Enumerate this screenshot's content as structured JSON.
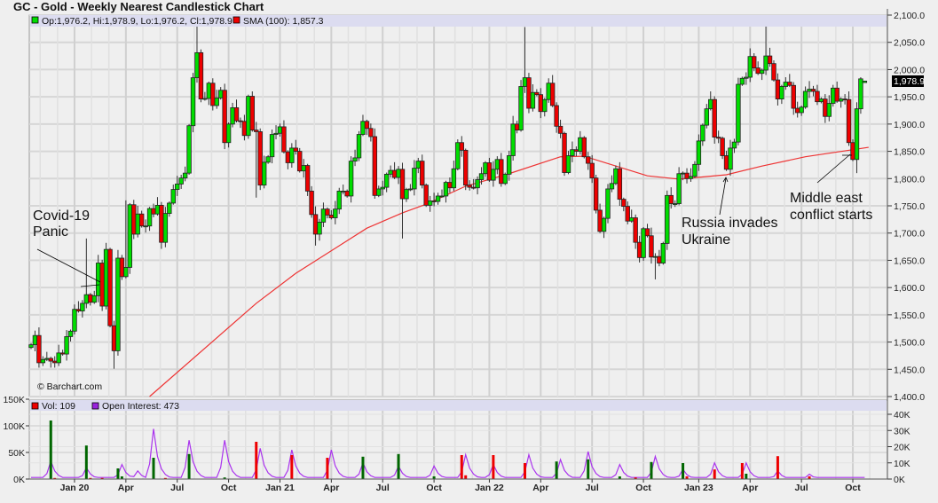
{
  "title": "GC - Gold - Weekly Nearest Candlestick Chart",
  "legend": {
    "ohlc": "Op:1,976.2, Hi:1,978.9, Lo:1,976.2, Cl:1,978.9",
    "sma": "SMA (100): 1,857.3",
    "vol": "Vol: 109",
    "oi": "Open Interest: 473"
  },
  "watermark": "© Barchart.com",
  "last_price_label": "1,978.9",
  "colors": {
    "up": "#00dd00",
    "down": "#ee0000",
    "sma": "#ee3333",
    "oi": "#aa33ee",
    "vol_up": "#006600",
    "vol_down": "#ee0000",
    "legend_band": "#dcdcf0"
  },
  "annotations": [
    {
      "lines": [
        "Covid-19",
        "Panic"
      ]
    },
    {
      "lines": [
        "Russia invades",
        "Ukraine"
      ]
    },
    {
      "lines": [
        "Middle east",
        "conflict starts"
      ]
    }
  ],
  "chart_data": {
    "type": "candlestick",
    "title": "GC - Gold - Weekly Nearest Candlestick Chart",
    "price_axis": {
      "range": [
        1400,
        2100
      ],
      "ticks": [
        "2,100.0",
        "2,050.0",
        "2,000.0",
        "1,950.0",
        "1,900.0",
        "1,850.0",
        "1,800.0",
        "1,750.0",
        "1,700.0",
        "1,650.0",
        "1,600.0",
        "1,550.0",
        "1,500.0",
        "1,450.0",
        "1,400.0"
      ],
      "tick_values": [
        2100,
        2050,
        2000,
        1950,
        1900,
        1850,
        1800,
        1750,
        1700,
        1650,
        1600,
        1550,
        1500,
        1450,
        1400
      ]
    },
    "x_ticks": [
      {
        "label": "Jan 20",
        "week": 11
      },
      {
        "label": "Apr",
        "week": 24
      },
      {
        "label": "Jul",
        "week": 37
      },
      {
        "label": "Oct",
        "week": 50
      },
      {
        "label": "Jan 21",
        "week": 63
      },
      {
        "label": "Apr",
        "week": 76
      },
      {
        "label": "Jul",
        "week": 89
      },
      {
        "label": "Oct",
        "week": 102
      },
      {
        "label": "Jan 22",
        "week": 116
      },
      {
        "label": "Apr",
        "week": 129
      },
      {
        "label": "Jul",
        "week": 142
      },
      {
        "label": "Oct",
        "week": 155
      },
      {
        "label": "Jan 23",
        "week": 169
      },
      {
        "label": "Apr",
        "week": 182
      },
      {
        "label": "Jul",
        "week": 195
      },
      {
        "label": "Oct",
        "week": 208
      }
    ],
    "first_open": 1490,
    "weekly_close": [
      1495,
      1512,
      1462,
      1468,
      1470,
      1465,
      1462,
      1480,
      1478,
      1510,
      1520,
      1560,
      1557,
      1571,
      1587,
      1573,
      1585,
      1645,
      1566,
      1670,
      1530,
      1484,
      1654,
      1620,
      1637,
      1752,
      1698,
      1735,
      1713,
      1713,
      1745,
      1735,
      1751,
      1683,
      1736,
      1755,
      1780,
      1790,
      1801,
      1810,
      1897,
      1985,
      2031,
      1946,
      1947,
      1975,
      1934,
      1948,
      1962,
      1866,
      1900,
      1930,
      1906,
      1905,
      1879,
      1951,
      1889,
      1886,
      1788,
      1830,
      1840,
      1881,
      1883,
      1895,
      1849,
      1829,
      1856,
      1850,
      1814,
      1824,
      1777,
      1734,
      1698,
      1720,
      1744,
      1733,
      1728,
      1744,
      1777,
      1777,
      1768,
      1832,
      1838,
      1881,
      1905,
      1892,
      1877,
      1769,
      1781,
      1784,
      1808,
      1815,
      1802,
      1817,
      1763,
      1780,
      1781,
      1819,
      1832,
      1788,
      1751,
      1759,
      1758,
      1768,
      1768,
      1793,
      1783,
      1818,
      1866,
      1852,
      1788,
      1784,
      1783,
      1798,
      1809,
      1829,
      1797,
      1817,
      1835,
      1791,
      1808,
      1842,
      1900,
      1889,
      1969,
      1985,
      1929,
      1958,
      1954,
      1923,
      1945,
      1975,
      1934,
      1896,
      1883,
      1811,
      1842,
      1853,
      1850,
      1875,
      1840,
      1828,
      1801,
      1742,
      1703,
      1727,
      1781,
      1791,
      1818,
      1762,
      1749,
      1722,
      1728,
      1683,
      1655,
      1708,
      1695,
      1656,
      1657,
      1645,
      1681,
      1769,
      1754,
      1754,
      1809,
      1810,
      1800,
      1804,
      1826,
      1869,
      1898,
      1928,
      1945,
      1876,
      1874,
      1842,
      1817,
      1856,
      1867,
      1973,
      1984,
      1986,
      2024,
      2003,
      1993,
      1999,
      2025,
      2011,
      1981,
      1946,
      1969,
      1977,
      1971,
      1929,
      1921,
      1931,
      1960,
      1964,
      1960,
      1941,
      1946,
      1914,
      1938,
      1966,
      1942,
      1946,
      1945,
      1866,
      1835,
      1928,
      1983
    ],
    "last_bar": {
      "open": 1976.2,
      "high": 1978.9,
      "low": 1976.2,
      "close": 1978.9
    },
    "high_overrides": [
      [
        42,
        2089
      ],
      [
        125,
        2078
      ],
      [
        186,
        2085
      ],
      [
        24,
        1760
      ],
      [
        14,
        1690
      ]
    ],
    "low_overrides": [
      [
        21,
        1451
      ],
      [
        57,
        1765
      ],
      [
        72,
        1677
      ],
      [
        94,
        1690
      ],
      [
        158,
        1615
      ],
      [
        209,
        1810
      ]
    ],
    "sma_100": {
      "label": "SMA (100)",
      "last": 1857.3,
      "points": [
        [
          30,
          1400
        ],
        [
          57,
          1571
        ],
        [
          67,
          1626
        ],
        [
          85,
          1709
        ],
        [
          94,
          1737
        ],
        [
          100,
          1753
        ],
        [
          110,
          1786
        ],
        [
          121,
          1809
        ],
        [
          134,
          1840
        ],
        [
          140,
          1841
        ],
        [
          156,
          1805
        ],
        [
          164,
          1799
        ],
        [
          176,
          1807
        ],
        [
          185,
          1823
        ],
        [
          196,
          1840
        ],
        [
          212,
          1857.3
        ]
      ]
    },
    "volume_axis": {
      "range": [
        0,
        150
      ],
      "unit": "K",
      "ticks": [
        "150K",
        "100K",
        "50K",
        "0K"
      ],
      "tick_values": [
        150,
        100,
        50,
        0
      ]
    },
    "oi_axis": {
      "range": [
        0,
        40
      ],
      "unit": "K",
      "ticks": [
        "40K",
        "30K",
        "20K",
        "10K",
        "0K"
      ],
      "tick_values": [
        40,
        30,
        20,
        10,
        0
      ]
    },
    "volume_spikes_k": [
      [
        5,
        110,
        "up"
      ],
      [
        6,
        2,
        "down"
      ],
      [
        14,
        63,
        "up"
      ],
      [
        15,
        2,
        "down"
      ],
      [
        18,
        2,
        "down"
      ],
      [
        22,
        20,
        "up"
      ],
      [
        23,
        5,
        "up"
      ],
      [
        31,
        40,
        "up"
      ],
      [
        34,
        2,
        "down"
      ],
      [
        40,
        47,
        "up"
      ],
      [
        49,
        3,
        "up"
      ],
      [
        57,
        70,
        "down"
      ],
      [
        66,
        45,
        "down"
      ],
      [
        75,
        40,
        "down"
      ],
      [
        84,
        42,
        "up"
      ],
      [
        93,
        47,
        "up"
      ],
      [
        102,
        5,
        "up"
      ],
      [
        109,
        45,
        "down"
      ],
      [
        110,
        7,
        "down"
      ],
      [
        117,
        45,
        "down"
      ],
      [
        125,
        30,
        "down"
      ],
      [
        133,
        33,
        "up"
      ],
      [
        141,
        37,
        "up"
      ],
      [
        149,
        5,
        "up"
      ],
      [
        153,
        3,
        "down"
      ],
      [
        157,
        32,
        "up"
      ],
      [
        165,
        30,
        "up"
      ],
      [
        166,
        5,
        "down"
      ],
      [
        173,
        18,
        "down"
      ],
      [
        180,
        30,
        "down"
      ],
      [
        181,
        10,
        "up"
      ],
      [
        189,
        43,
        "down"
      ],
      [
        197,
        5,
        "down"
      ]
    ],
    "open_interest_peaks_k": [
      [
        5,
        11
      ],
      [
        14,
        7
      ],
      [
        23,
        9
      ],
      [
        27,
        5
      ],
      [
        31,
        31
      ],
      [
        40,
        24
      ],
      [
        49,
        24
      ],
      [
        58,
        19
      ],
      [
        66,
        18
      ],
      [
        76,
        18
      ],
      [
        84,
        10
      ],
      [
        93,
        8
      ],
      [
        102,
        8
      ],
      [
        110,
        15
      ],
      [
        117,
        9
      ],
      [
        126,
        15
      ],
      [
        134,
        12
      ],
      [
        141,
        17
      ],
      [
        149,
        9
      ],
      [
        158,
        14
      ],
      [
        165,
        6
      ],
      [
        173,
        10
      ],
      [
        181,
        10
      ],
      [
        189,
        5
      ],
      [
        197,
        3
      ]
    ]
  }
}
